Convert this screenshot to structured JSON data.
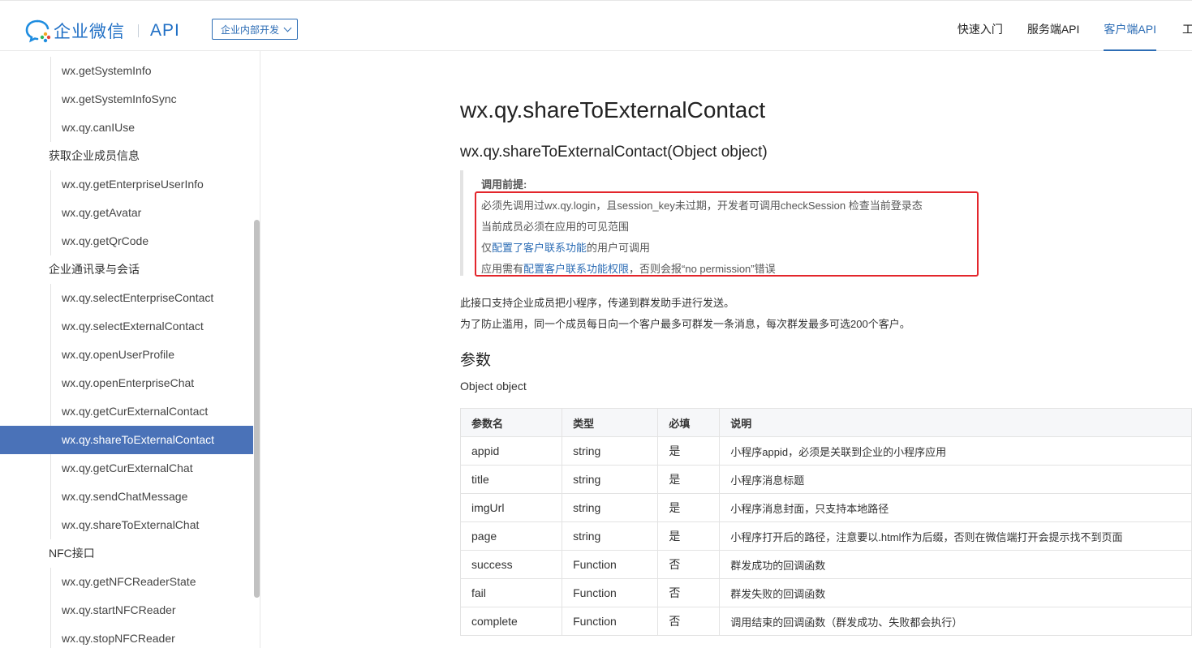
{
  "header": {
    "logo_text": "企业微信",
    "logo_api": "API",
    "dev_select": "企业内部开发",
    "nav": [
      "快速入门",
      "服务端API",
      "客户端API",
      "工"
    ]
  },
  "sidebar": {
    "items": [
      {
        "label": "wx.getSystemInfo",
        "kind": "sub"
      },
      {
        "label": "wx.getSystemInfoSync",
        "kind": "sub"
      },
      {
        "label": "wx.qy.canIUse",
        "kind": "sub"
      },
      {
        "label": "获取企业成员信息",
        "kind": "group"
      },
      {
        "label": "wx.qy.getEnterpriseUserInfo",
        "kind": "sub"
      },
      {
        "label": "wx.qy.getAvatar",
        "kind": "sub"
      },
      {
        "label": "wx.qy.getQrCode",
        "kind": "sub"
      },
      {
        "label": "企业通讯录与会话",
        "kind": "group"
      },
      {
        "label": "wx.qy.selectEnterpriseContact",
        "kind": "sub"
      },
      {
        "label": "wx.qy.selectExternalContact",
        "kind": "sub"
      },
      {
        "label": "wx.qy.openUserProfile",
        "kind": "sub"
      },
      {
        "label": "wx.qy.openEnterpriseChat",
        "kind": "sub"
      },
      {
        "label": "wx.qy.getCurExternalContact",
        "kind": "sub"
      },
      {
        "label": "wx.qy.shareToExternalContact",
        "kind": "sub",
        "active": true
      },
      {
        "label": "wx.qy.getCurExternalChat",
        "kind": "sub"
      },
      {
        "label": "wx.qy.sendChatMessage",
        "kind": "sub"
      },
      {
        "label": "wx.qy.shareToExternalChat",
        "kind": "sub"
      },
      {
        "label": "NFC接口",
        "kind": "group"
      },
      {
        "label": "wx.qy.getNFCReaderState",
        "kind": "sub"
      },
      {
        "label": "wx.qy.startNFCReader",
        "kind": "sub"
      },
      {
        "label": "wx.qy.stopNFCReader",
        "kind": "sub"
      }
    ]
  },
  "main": {
    "title": "wx.qy.shareToExternalContact",
    "signature": "wx.qy.shareToExternalContact(Object object)",
    "note_title": "调用前提:",
    "note_lines": [
      {
        "pre": "必须先调用过wx.qy.login，且session_key未过期，开发者可调用checkSession 检查当前登录态",
        "link": "",
        "post": ""
      },
      {
        "pre": "当前成员必须在应用的可见范围",
        "link": "",
        "post": ""
      },
      {
        "pre": "仅",
        "link": "配置了客户联系功能",
        "post": "的用户可调用"
      },
      {
        "pre": "应用需有",
        "link": "配置客户联系功能权限",
        "post": "，否则会报“no permission”错误"
      }
    ],
    "desc1": "此接口支持企业成员把小程序，传递到群发助手进行发送。",
    "desc2": "为了防止滥用，同一个成员每日向一个客户最多可群发一条消息，每次群发最多可选200个客户。",
    "params_heading": "参数",
    "object_label": "Object object",
    "table": {
      "headers": [
        "参数名",
        "类型",
        "必填",
        "说明"
      ],
      "rows": [
        [
          "appid",
          "string",
          "是",
          "小程序appid，必须是关联到企业的小程序应用"
        ],
        [
          "title",
          "string",
          "是",
          "小程序消息标题"
        ],
        [
          "imgUrl",
          "string",
          "是",
          "小程序消息封面，只支持本地路径"
        ],
        [
          "page",
          "string",
          "是",
          "小程序打开后的路径，注意要以.html作为后缀，否则在微信端打开会提示找不到页面"
        ],
        [
          "success",
          "Function",
          "否",
          "群发成功的回调函数"
        ],
        [
          "fail",
          "Function",
          "否",
          "群发失败的回调函数"
        ],
        [
          "complete",
          "Function",
          "否",
          "调用结束的回调函数（群发成功、失败都会执行）"
        ]
      ]
    }
  },
  "colors": {
    "brand": "#1f6fc5",
    "accent": "#2d6db5",
    "active_bg": "#4a72b8",
    "highlight_border": "#e3262c"
  }
}
